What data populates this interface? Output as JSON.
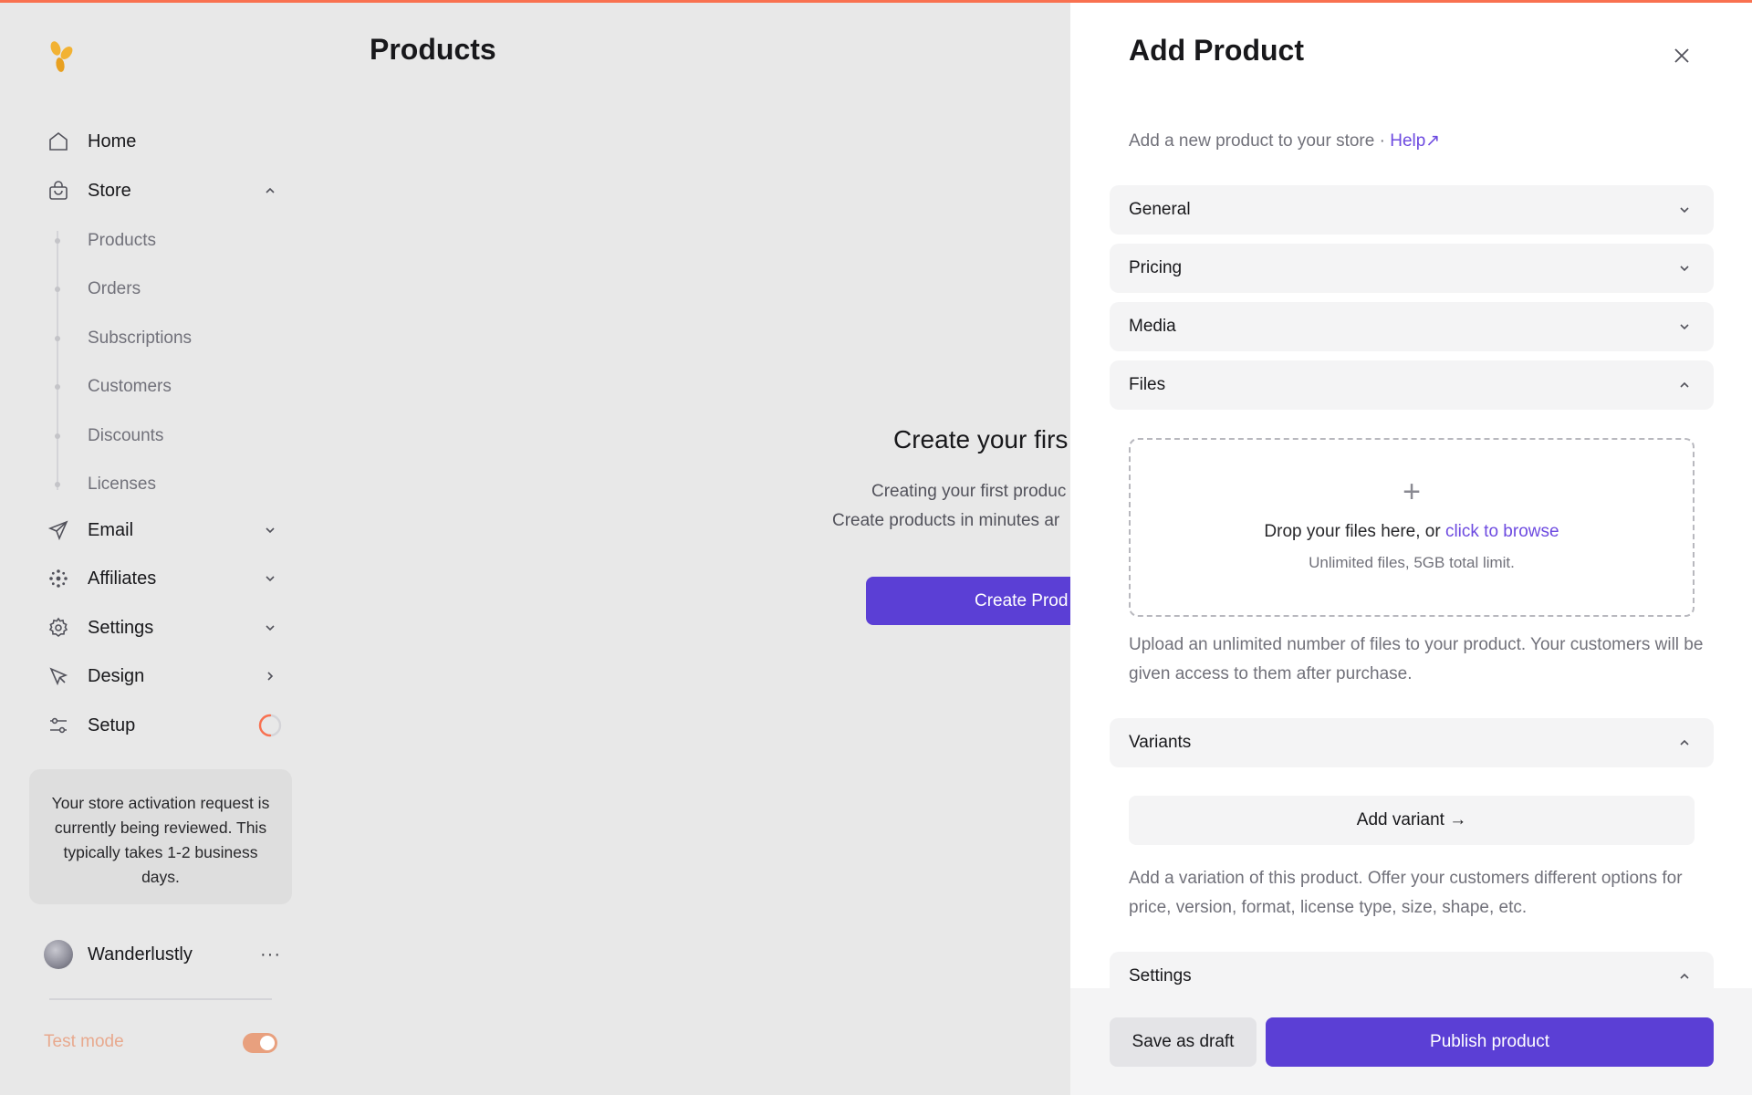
{
  "colors": {
    "accent": "#5b3fd5",
    "link": "#6d4ae0",
    "topbar": "#f97150",
    "setup_ring": "#f97150"
  },
  "sidebar": {
    "items": [
      {
        "label": "Home",
        "icon": "home-icon"
      },
      {
        "label": "Store",
        "icon": "shopping-bag-icon",
        "expanded": true
      },
      {
        "label": "Email",
        "icon": "send-icon"
      },
      {
        "label": "Affiliates",
        "icon": "affiliates-icon"
      },
      {
        "label": "Settings",
        "icon": "gear-icon"
      },
      {
        "label": "Design",
        "icon": "cursor-icon"
      },
      {
        "label": "Setup",
        "icon": "sliders-icon",
        "progress": 0.5
      }
    ],
    "store_subitems": [
      "Products",
      "Orders",
      "Subscriptions",
      "Customers",
      "Discounts",
      "Licenses"
    ],
    "activation_notice": "Your store activation request is currently being reviewed. This typically takes 1-2 business days.",
    "user": {
      "name": "Wanderlustly",
      "more": "···"
    },
    "test_mode": {
      "label": "Test mode",
      "enabled": true
    }
  },
  "main": {
    "title": "Products",
    "empty_state": {
      "title": "Create your firs",
      "line1": "Creating your first produc",
      "line2": "Create products in minutes ar",
      "button": "Create Prod"
    }
  },
  "panel": {
    "title": "Add Product",
    "subtitle": "Add a new product to your store · ",
    "help_link": "Help↗",
    "sections": [
      "General",
      "Pricing",
      "Media",
      "Files",
      "Variants",
      "Settings"
    ],
    "files": {
      "plus": "+",
      "drop_text": "Drop your files here, or ",
      "browse_link": "click to browse",
      "limit": "Unlimited files, 5GB total limit.",
      "description": "Upload an unlimited number of files to your product. Your customers will be given access to them after purchase."
    },
    "variants": {
      "add_button": "Add variant →",
      "description": "Add a variation of this product. Offer your customers different options for price, version, format, license type, size, shape, etc."
    },
    "footer": {
      "draft": "Save as draft",
      "publish": "Publish product"
    }
  }
}
